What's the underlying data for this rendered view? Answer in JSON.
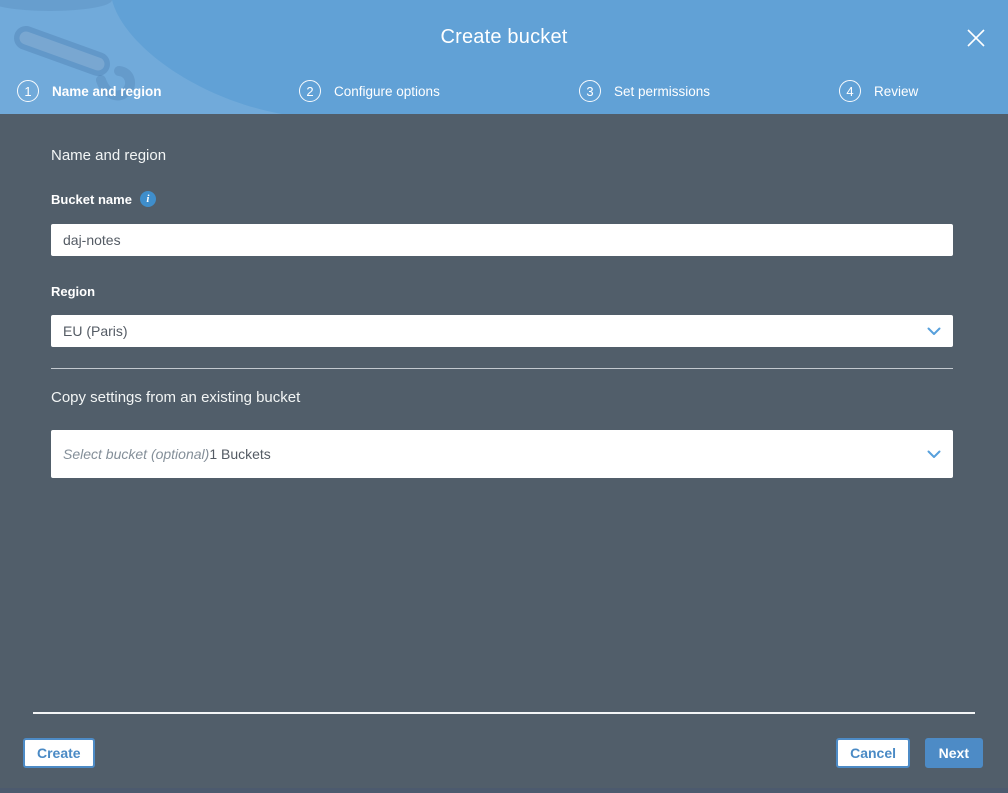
{
  "modal": {
    "title": "Create bucket"
  },
  "icons": {
    "close": "✕",
    "info": "i",
    "chevron_down": "chevron-down"
  },
  "steps": [
    {
      "number": "1",
      "label": "Name and region",
      "active": true
    },
    {
      "number": "2",
      "label": "Configure options",
      "active": false
    },
    {
      "number": "3",
      "label": "Set permissions",
      "active": false
    },
    {
      "number": "4",
      "label": "Review",
      "active": false
    }
  ],
  "form": {
    "section_heading": "Name and region",
    "bucket_name": {
      "label": "Bucket name",
      "value": "daj-notes"
    },
    "region": {
      "label": "Region",
      "selected_option": "EU (Paris)"
    },
    "copy_settings": {
      "heading": "Copy settings from an existing bucket",
      "placeholder": "Select bucket (optional)",
      "bucket_count": "1 Buckets"
    }
  },
  "footer": {
    "create_label": "Create",
    "cancel_label": "Cancel",
    "next_label": "Next"
  },
  "colors": {
    "header_blue": "#61a1d6",
    "body_slate": "#515e6a",
    "accent_blue": "#4d8bc6",
    "info_icon_blue": "#3f8ecb"
  }
}
